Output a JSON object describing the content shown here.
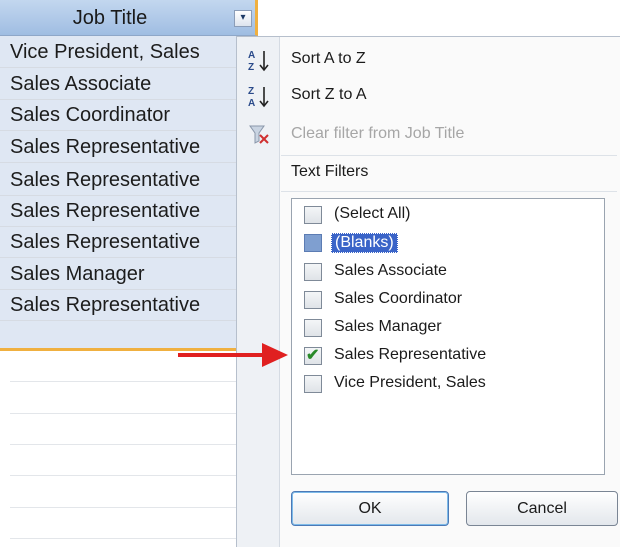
{
  "column_header": {
    "label": "Job Title",
    "dropdown_icon": "filter-dropdown-icon"
  },
  "cells": [
    "Vice President, Sales",
    "Sales Associate",
    "Sales Coordinator",
    "Sales Representative",
    "Sales Representative",
    "Sales Representative",
    "Sales Representative",
    "Sales Manager",
    "Sales Representative"
  ],
  "menu": {
    "sort_az": "Sort A to Z",
    "sort_za": "Sort Z to A",
    "clear_filter": "Clear filter from Job Title",
    "text_filters": "Text Filters"
  },
  "filter_list": [
    {
      "label": "(Select All)",
      "checked": false
    },
    {
      "label": "(Blanks)",
      "checked": false,
      "highlighted": true
    },
    {
      "label": "Sales Associate",
      "checked": false
    },
    {
      "label": "Sales Coordinator",
      "checked": false
    },
    {
      "label": "Sales Manager",
      "checked": false
    },
    {
      "label": "Sales Representative",
      "checked": true
    },
    {
      "label": "Vice President, Sales",
      "checked": false
    }
  ],
  "buttons": {
    "ok": "OK",
    "cancel": "Cancel"
  },
  "colors": {
    "arrow": "#e02020",
    "header": "#b2cbea",
    "selection_border": "#f0b040"
  }
}
